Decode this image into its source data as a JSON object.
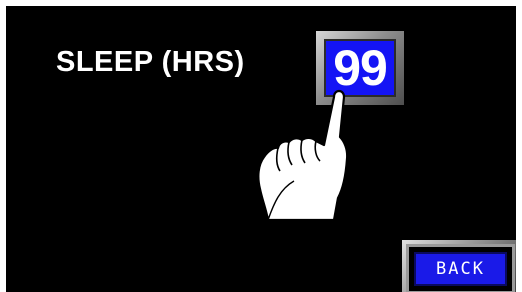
{
  "screen": {
    "sleep_label": "SLEEP (HRS)",
    "sleep_value": "99",
    "back_label": "BACK"
  },
  "icons": {
    "hand": "pointing-hand-icon"
  },
  "colors": {
    "background": "#000000",
    "value_box": "#1414f5",
    "back_button": "#1a1ae8",
    "text": "#ffffff"
  }
}
